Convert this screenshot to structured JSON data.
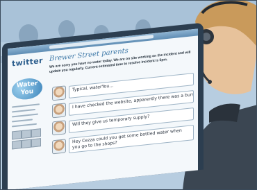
{
  "screen": {
    "brand": "twitter",
    "page_title": "Brewer Street parents",
    "notice": "We are sorry you have no water today. We are on site working on the incident and will update you regularly. Current estimated time to resolve incident is 5pm.",
    "logo_line1": "Water",
    "logo_line2": "You"
  },
  "chat": [
    {
      "text": "Typical, waterYou..."
    },
    {
      "text": "I have checked the website, apparently there was a burst"
    },
    {
      "text": "Will they give us temporary supply?"
    },
    {
      "text": "Hey Cezza could you get some bottled water when you go to the shops?"
    }
  ]
}
